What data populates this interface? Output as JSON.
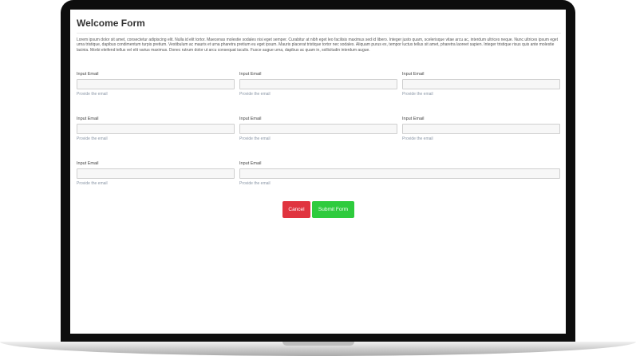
{
  "form": {
    "title": "Welcome Form",
    "intro": "Lorem ipsum dolor sit amet, consectetur adipiscing elit. Nulla id elit tortor. Maecenas molestie sodales nisi eget semper. Curabitur at nibh eget leo facilisis maximus sed id libero. Integer justo quam, scelerisque vitae arcu ac, interdum ultrices neque. Nunc ultrices ipsum eget urna tristique, dapibus condimentum turpis pretium. Vestibulum ac mauris et urna pharetra pretium eu eget ipsum. Mauris placerat tristique tortor nec sodales. Aliquam purus ex, tempor luctus tellus sit amet, pharetra laoreet sapien. Integer tristique risus quis ante molestie lacinia. Morbi eleifend tellus vel elit varius maximus. Donec rutrum dolor ut arcu consequat iaculis. Fusce augue urna, dapibus ac quam in, sollicitudin interdum augue.",
    "fields": [
      {
        "label": "Input Email",
        "help": "Provide the email",
        "value": "",
        "placeholder": ""
      },
      {
        "label": "Input Email",
        "help": "Provide the email",
        "value": "",
        "placeholder": ""
      },
      {
        "label": "Input Email",
        "help": "Provide the email",
        "value": "",
        "placeholder": ""
      },
      {
        "label": "Input Email",
        "help": "Provide the email",
        "value": "",
        "placeholder": ""
      },
      {
        "label": "Input Email",
        "help": "Provide the email",
        "value": "",
        "placeholder": ""
      },
      {
        "label": "Input Email",
        "help": "Provide the email",
        "value": "",
        "placeholder": ""
      },
      {
        "label": "Input Email",
        "help": "Provide the email",
        "value": "",
        "placeholder": ""
      },
      {
        "label": "Input Email",
        "help": "Provide the email",
        "value": "",
        "placeholder": ""
      }
    ],
    "buttons": {
      "cancel": "Cancel",
      "submit": "Submit Form"
    }
  },
  "colors": {
    "cancel": "#e0343f",
    "submit": "#2ecb3d"
  }
}
